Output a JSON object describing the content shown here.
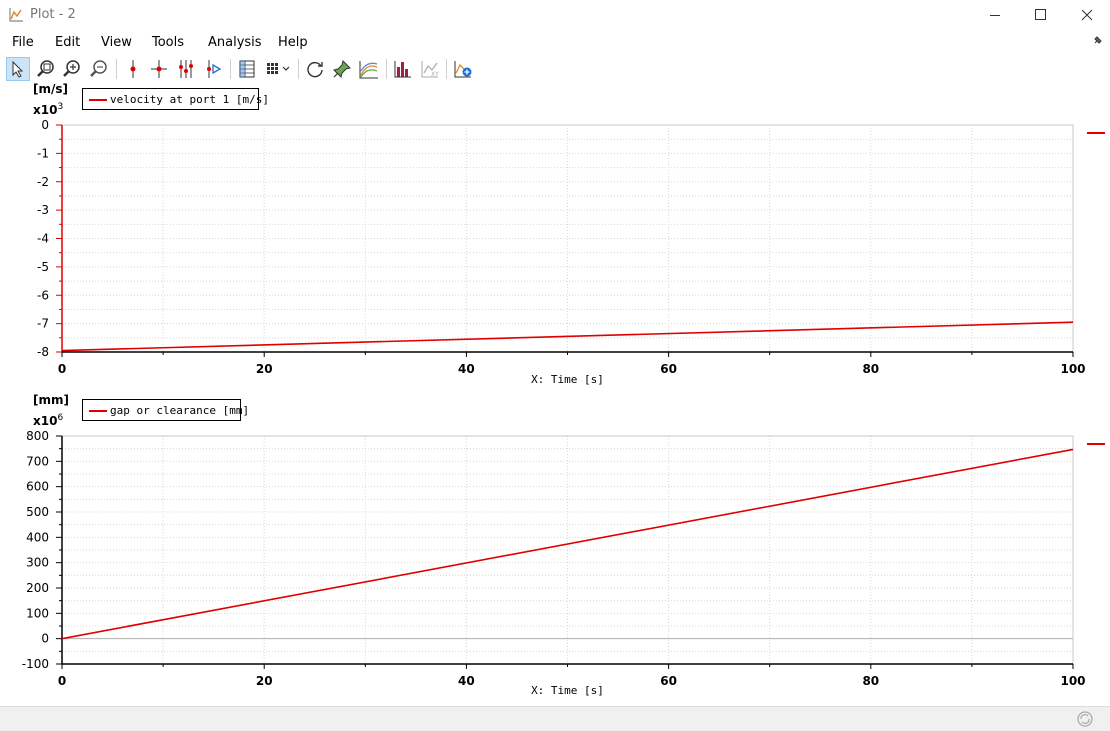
{
  "window": {
    "title": "Plot - 2"
  },
  "menu": [
    "File",
    "Edit",
    "View",
    "Tools",
    "Analysis",
    "Help"
  ],
  "toolbar": [
    "select-arrow-icon",
    "zoom-region-icon",
    "zoom-in-icon",
    "zoom-out-icon",
    "cursor-vertical-icon",
    "cursor-cross-icon",
    "cursor-multi-icon",
    "cursor-play-icon",
    "data-table-icon",
    "grid-layout-icon",
    "refresh-icon",
    "pin-icon",
    "curve-style-icon",
    "histogram-icon",
    "xy-plot-icon",
    "new-plot-icon"
  ],
  "accent_color": "#e00000",
  "chart_data": [
    {
      "type": "line",
      "unit_label": "[m/s]",
      "multiplier": "x10",
      "multiplier_exp": "3",
      "xlabel": "X: Time [s]",
      "xlim": [
        0,
        100
      ],
      "ylim": [
        -8,
        0
      ],
      "xticks": [
        0,
        20,
        40,
        60,
        80,
        100
      ],
      "yticks": [
        0,
        -1,
        -2,
        -3,
        -4,
        -5,
        -6,
        -7,
        -8
      ],
      "grid": true,
      "legend_position": "top-left",
      "series": [
        {
          "name": "velocity at port 1 [m/s]",
          "color": "#e00000",
          "x": [
            0,
            100
          ],
          "y": [
            -7.95,
            -6.95
          ]
        }
      ]
    },
    {
      "type": "line",
      "unit_label": "[mm]",
      "multiplier": "x10",
      "multiplier_exp": "6",
      "xlabel": "X: Time [s]",
      "xlim": [
        0,
        100
      ],
      "ylim": [
        -100,
        800
      ],
      "xticks": [
        0,
        20,
        40,
        60,
        80,
        100
      ],
      "yticks": [
        800,
        700,
        600,
        500,
        400,
        300,
        200,
        100,
        0,
        -100
      ],
      "grid": true,
      "legend_position": "top-left",
      "series": [
        {
          "name": "gap or clearance [mm]",
          "color": "#e00000",
          "x": [
            0,
            100
          ],
          "y": [
            0,
            747
          ]
        }
      ]
    }
  ]
}
